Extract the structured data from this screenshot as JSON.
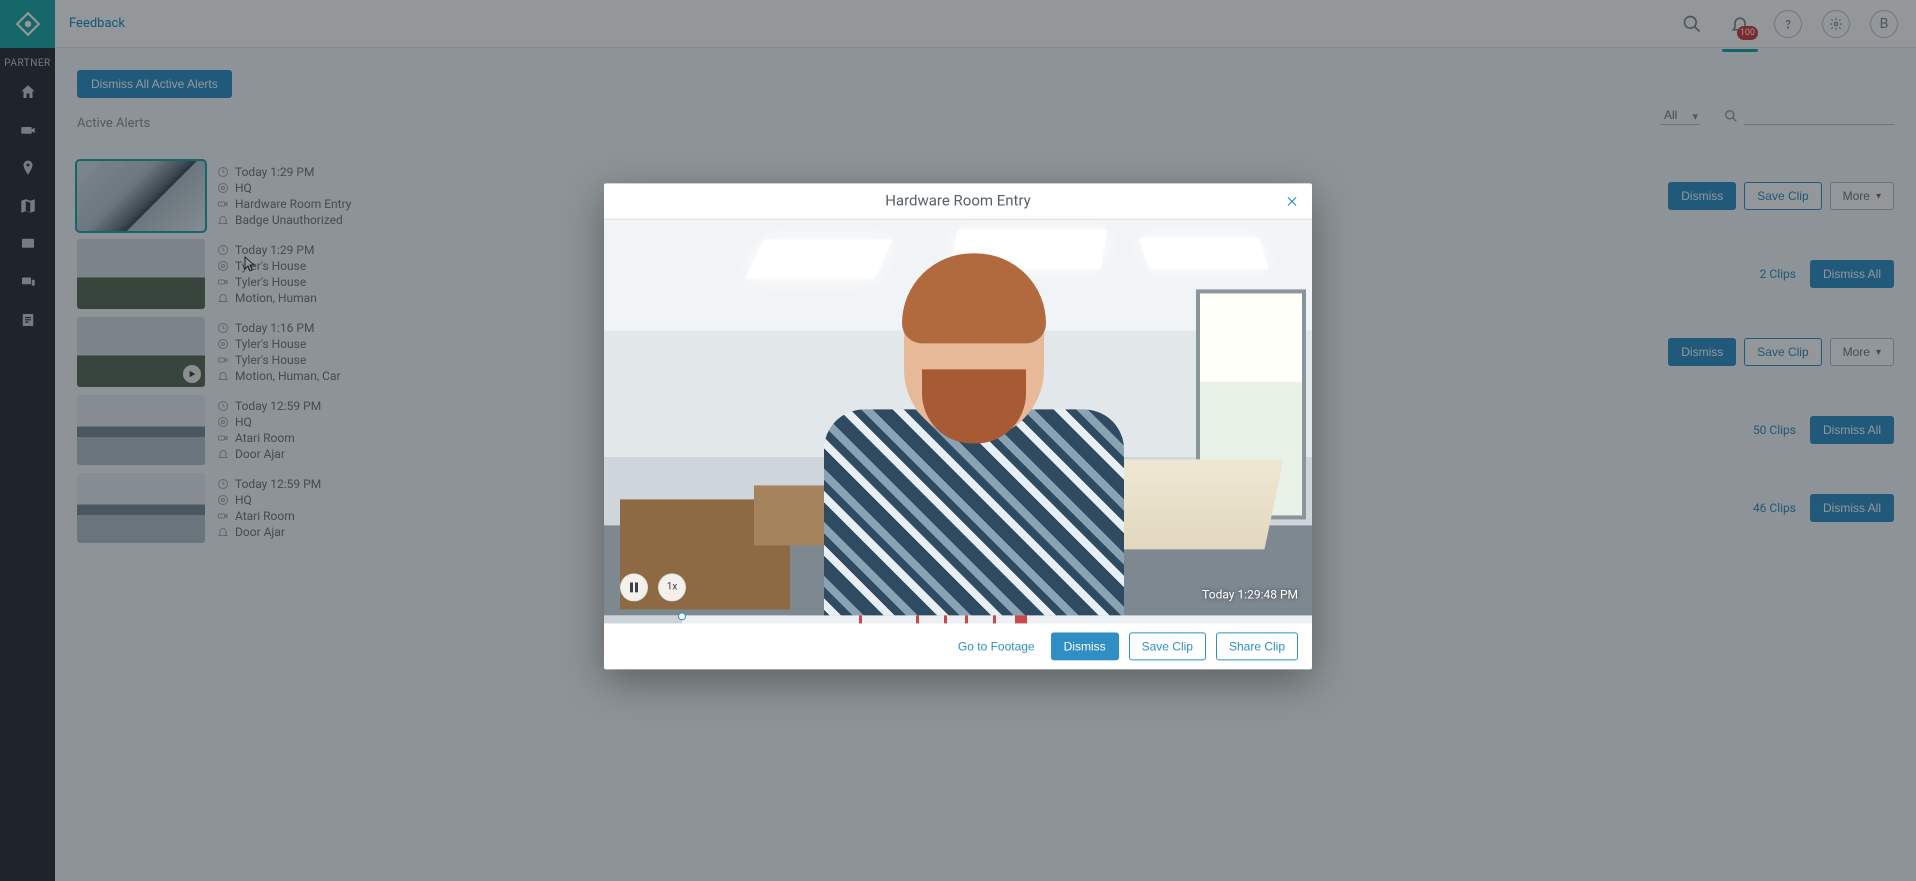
{
  "colors": {
    "accent": "#1aa6a6",
    "primary_blue": "#2f8fc4",
    "danger": "#c74a4a"
  },
  "topbar": {
    "feedback_label": "Feedback",
    "notification_count": "100",
    "avatar_letter": "B"
  },
  "sidebar": {
    "partner_label": "PARTNER"
  },
  "page": {
    "dismiss_all_alerts": "Dismiss All Active Alerts",
    "section_title": "Active Alerts",
    "filter_selected": "All",
    "search_placeholder": ""
  },
  "alerts": [
    {
      "time": "Today 1:29 PM",
      "account": "HQ",
      "camera": "Hardware Room Entry",
      "event": "Badge Unauthorized",
      "thumb_class": "thumb-office",
      "selected": true,
      "has_play": false,
      "actions": {
        "type": "single",
        "dismiss": "Dismiss",
        "save_clip": "Save Clip",
        "more": "More"
      }
    },
    {
      "time": "Today 1:29 PM",
      "account": "Tyler's House",
      "camera": "Tyler's House",
      "event": "Motion, Human",
      "thumb_class": "thumb-house",
      "selected": false,
      "has_play": false,
      "actions": {
        "type": "multi",
        "clip_count": "2 Clips",
        "dismiss_all": "Dismiss All"
      }
    },
    {
      "time": "Today 1:16 PM",
      "account": "Tyler's House",
      "camera": "Tyler's House",
      "event": "Motion, Human, Car",
      "thumb_class": "thumb-house",
      "selected": false,
      "has_play": true,
      "actions": {
        "type": "single",
        "dismiss": "Dismiss",
        "save_clip": "Save Clip",
        "more": "More"
      }
    },
    {
      "time": "Today 12:59 PM",
      "account": "HQ",
      "camera": "Atari Room",
      "event": "Door Ajar",
      "thumb_class": "thumb-room",
      "selected": false,
      "has_play": false,
      "actions": {
        "type": "multi",
        "clip_count": "50 Clips",
        "dismiss_all": "Dismiss All"
      }
    },
    {
      "time": "Today 12:59 PM",
      "account": "HQ",
      "camera": "Atari Room",
      "event": "Door Ajar",
      "thumb_class": "thumb-room",
      "selected": false,
      "has_play": false,
      "actions": {
        "type": "multi",
        "clip_count": "46 Clips",
        "dismiss_all": "Dismiss All"
      }
    }
  ],
  "dialog": {
    "title": "Hardware Room Entry",
    "timestamp": "Today 1:29:48 PM",
    "speed_label": "1x",
    "go_to_footage": "Go to Footage",
    "dismiss": "Dismiss",
    "save_clip": "Save Clip",
    "share_clip": "Share Clip",
    "timeline_marks_pct": [
      36,
      44,
      48,
      51,
      55
    ],
    "timeline_wide_pct": 58,
    "timeline_progress_pct": 11
  }
}
